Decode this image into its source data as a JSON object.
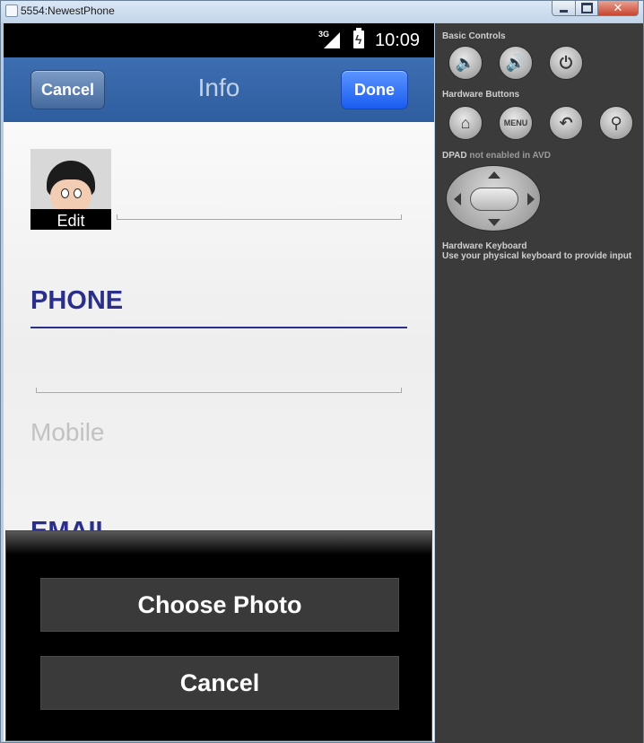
{
  "window": {
    "title": "5554:NewestPhone",
    "close_glyph": "✕"
  },
  "statusbar": {
    "network": "3G",
    "time": "10:09",
    "battery_glyph": "ϟ"
  },
  "navbar": {
    "cancel_label": "Cancel",
    "title": "Info",
    "done_label": "Done",
    "bar_color": "#3566a8",
    "done_color": "#1f62f5"
  },
  "contact": {
    "photo_edit_label": "Edit",
    "phone_header": "PHONE",
    "mobile_placeholder": "Mobile",
    "email_header": "EMAIL",
    "header_color": "#2b2f8a"
  },
  "action_sheet": {
    "choose_photo_label": "Choose Photo",
    "cancel_label": "Cancel"
  },
  "panel": {
    "basic_controls_label": "Basic Controls",
    "hardware_buttons_label": "Hardware Buttons",
    "dpad_label": "DPAD",
    "dpad_status": "not enabled in AVD",
    "keyboard_label": "Hardware Keyboard",
    "keyboard_hint": "Use your physical keyboard to provide input",
    "menu_label": "MENU",
    "icons": {
      "volume_down": "🔈",
      "volume_up": "🔊",
      "power": "⏻",
      "home": "⌂",
      "back": "↶",
      "search": "⚲"
    }
  }
}
